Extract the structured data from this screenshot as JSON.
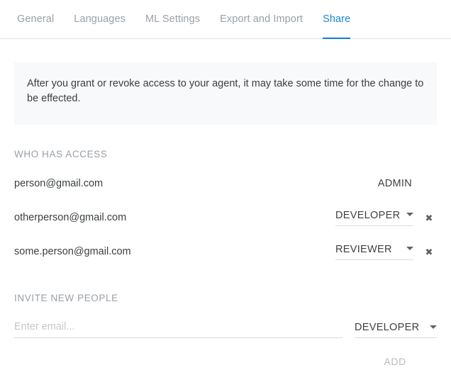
{
  "tabs": [
    {
      "label": "General",
      "active": false
    },
    {
      "label": "Languages",
      "active": false
    },
    {
      "label": "ML Settings",
      "active": false
    },
    {
      "label": "Export and Import",
      "active": false
    },
    {
      "label": "Share",
      "active": true
    }
  ],
  "notice": {
    "text": "After you grant or revoke access to your agent, it may take some time for the change to be effected."
  },
  "who_has_access": {
    "section_label": "WHO HAS ACCESS",
    "rows": [
      {
        "email": "person@gmail.com",
        "role": "ADMIN",
        "editable": false,
        "removable": false
      },
      {
        "email": "otherperson@gmail.com",
        "role": "DEVELOPER",
        "editable": true,
        "removable": true
      },
      {
        "email": "some.person@gmail.com",
        "role": "REVIEWER",
        "editable": true,
        "removable": true
      }
    ]
  },
  "invite": {
    "section_label": "INVITE NEW PEOPLE",
    "email_placeholder": "Enter email...",
    "email_value": "",
    "role": "DEVELOPER",
    "add_label": "ADD"
  },
  "icons": {
    "remove": "✖",
    "caret": "chevron-down-icon"
  },
  "colors": {
    "accent": "#0b80d3",
    "tab_inactive": "#9aa0a6",
    "text": "#3c4043",
    "notice_bg": "#f8f9fa",
    "rule": "#dadce0",
    "disabled": "#b6b9bc"
  }
}
